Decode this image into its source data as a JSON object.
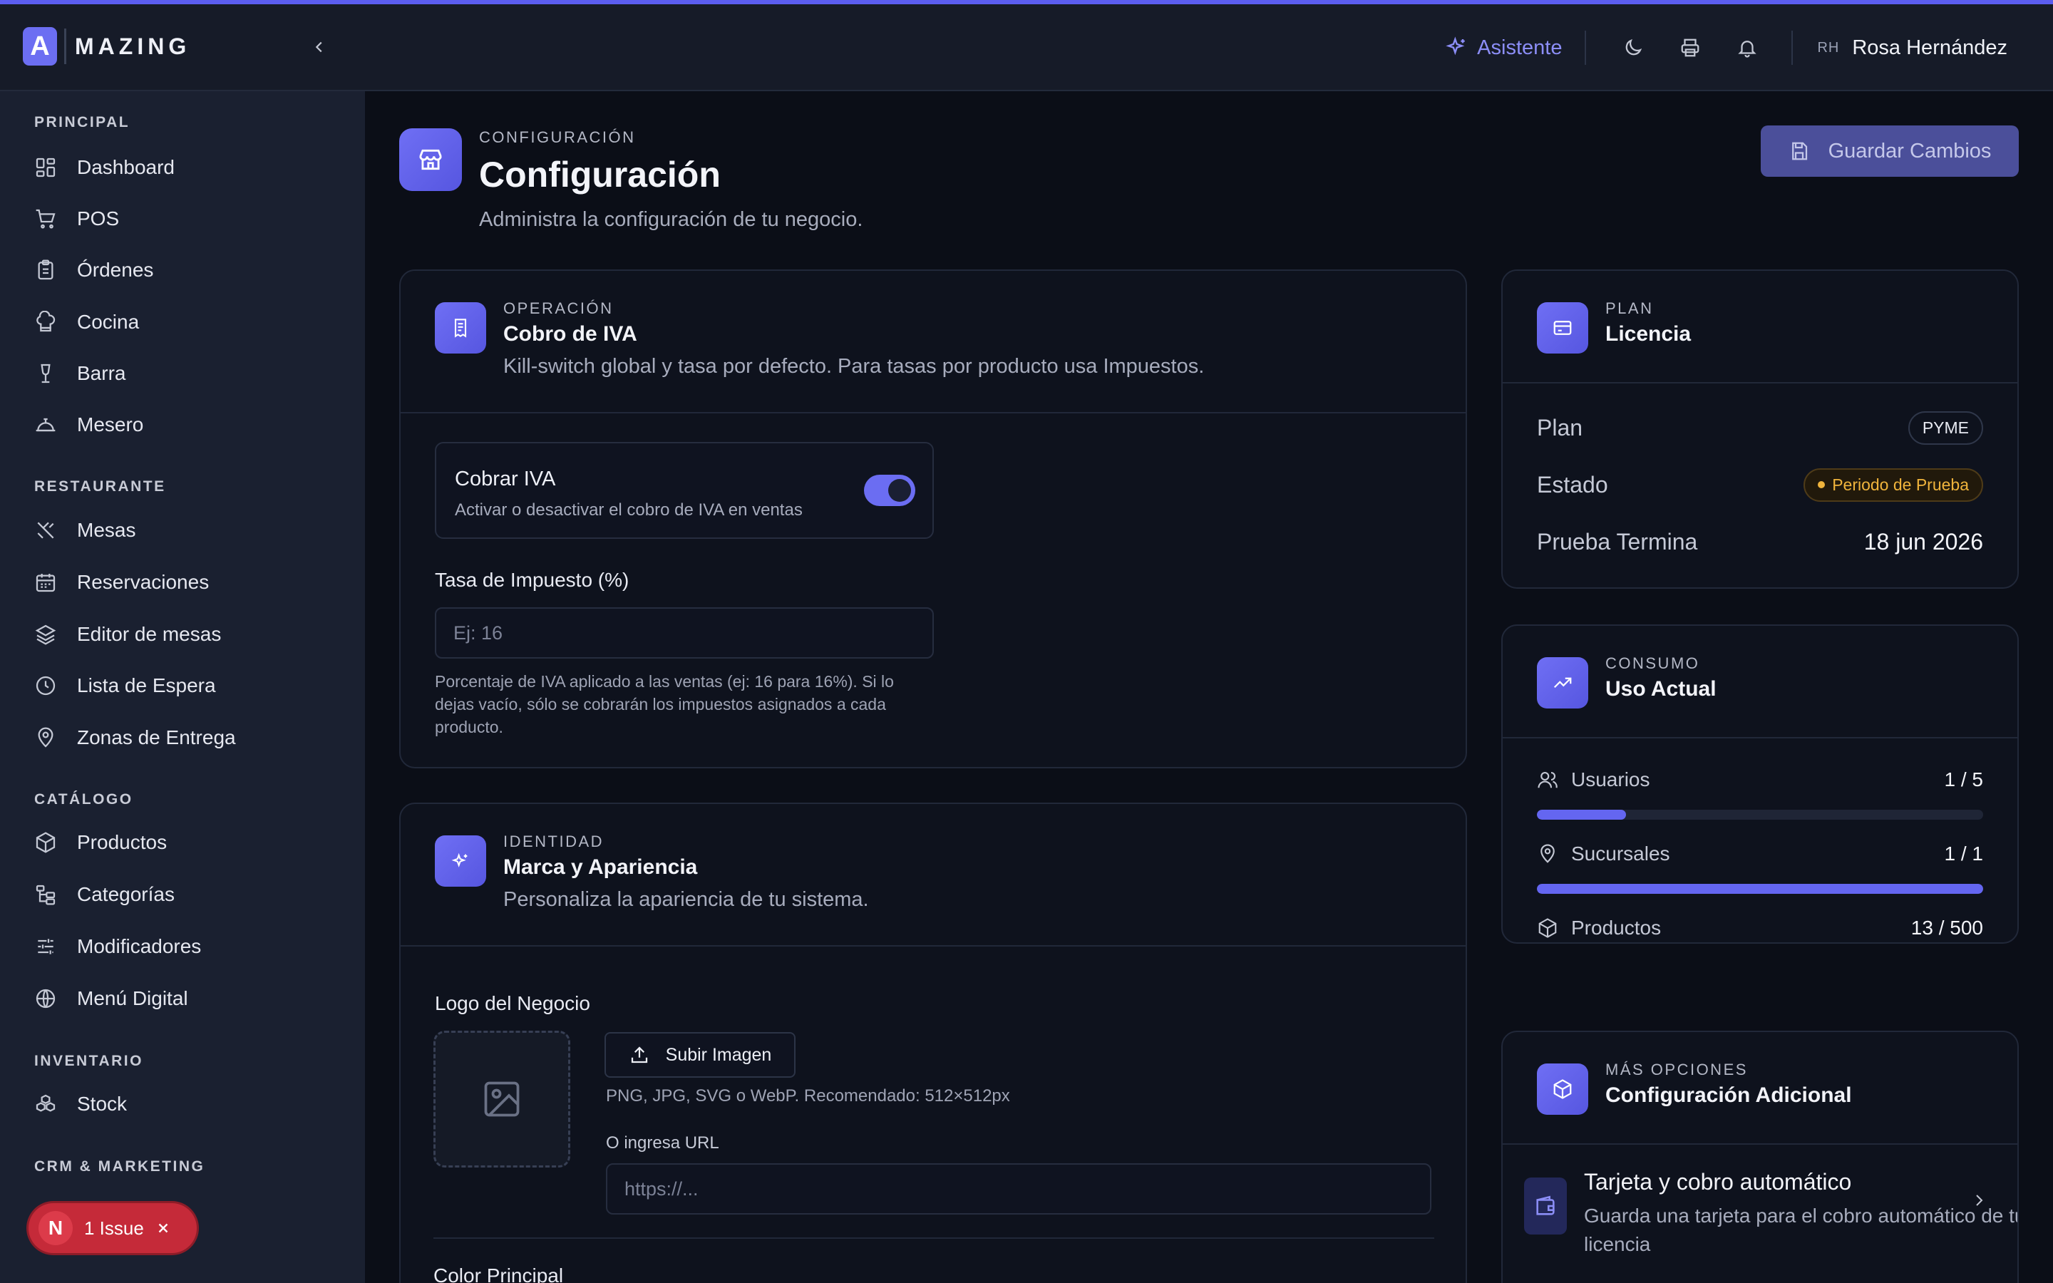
{
  "header": {
    "brand_letter": "A",
    "brand_name": "MAZING",
    "assistant_label": "Asistente",
    "user_initials": "RH",
    "user_name": "Rosa Hernández"
  },
  "sidebar": {
    "sections": [
      {
        "title": "PRINCIPAL",
        "items": [
          "Dashboard",
          "POS",
          "Órdenes",
          "Cocina",
          "Barra",
          "Mesero"
        ]
      },
      {
        "title": "RESTAURANTE",
        "items": [
          "Mesas",
          "Reservaciones",
          "Editor de mesas",
          "Lista de Espera",
          "Zonas de Entrega"
        ]
      },
      {
        "title": "CATÁLOGO",
        "items": [
          "Productos",
          "Categorías",
          "Modificadores",
          "Menú Digital"
        ]
      },
      {
        "title": "INVENTARIO",
        "items": [
          "Stock"
        ]
      },
      {
        "title": "CRM & MARKETING",
        "items": []
      }
    ]
  },
  "page": {
    "kicker": "CONFIGURACIÓN",
    "title": "Configuración",
    "subtitle": "Administra la configuración de tu negocio.",
    "save_label": "Guardar Cambios"
  },
  "iva_card": {
    "kicker": "OPERACIÓN",
    "title": "Cobro de IVA",
    "subtitle": "Kill-switch global y tasa por defecto. Para tasas por producto usa Impuestos.",
    "toggle_title": "Cobrar IVA",
    "toggle_sub": "Activar o desactivar el cobro de IVA en ventas",
    "toggle_on": true,
    "rate_label": "Tasa de Impuesto (%)",
    "rate_placeholder": "Ej: 16",
    "rate_help": "Porcentaje de IVA aplicado a las ventas (ej: 16 para 16%). Si lo dejas vacío, sólo se cobrarán los impuestos asignados a cada producto."
  },
  "brand_card": {
    "kicker": "IDENTIDAD",
    "title": "Marca y Apariencia",
    "subtitle": "Personaliza la apariencia de tu sistema.",
    "logo_label": "Logo del Negocio",
    "upload_label": "Subir Imagen",
    "upload_help": "PNG, JPG, SVG o WebP. Recomendado: 512×512px",
    "url_label": "O ingresa URL",
    "url_placeholder": "https://...",
    "color_label": "Color Principal"
  },
  "license_card": {
    "kicker": "PLAN",
    "title": "Licencia",
    "rows": [
      {
        "label": "Plan",
        "value": "PYME"
      },
      {
        "label": "Estado",
        "value": "Periodo de Prueba"
      },
      {
        "label": "Prueba Termina",
        "value": "18 jun 2026"
      }
    ]
  },
  "usage_card": {
    "kicker": "CONSUMO",
    "title": "Uso Actual",
    "rows": [
      {
        "label": "Usuarios",
        "value": "1 / 5",
        "fraction": 0.2
      },
      {
        "label": "Sucursales",
        "value": "1 / 1",
        "fraction": 1.0
      },
      {
        "label": "Productos",
        "value": "13 / 500",
        "fraction": 0.026
      }
    ]
  },
  "more_card": {
    "kicker": "MÁS OPCIONES",
    "title": "Configuración Adicional",
    "option_title": "Tarjeta y cobro automático",
    "option_sub": "Guarda una tarjeta para el cobro automático de tu licencia"
  },
  "issue_badge": {
    "letter": "N",
    "label": "1 Issue"
  },
  "colors": {
    "accent": "#6466f1",
    "warning": "#f0b43c",
    "background": "#0b0e17",
    "sidebar": "#1a2030"
  }
}
